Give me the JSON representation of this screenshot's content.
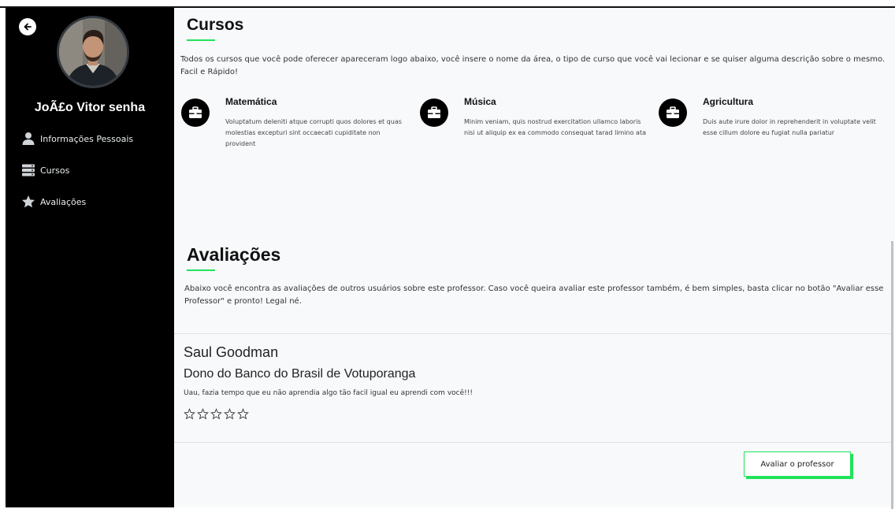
{
  "sidebar": {
    "profile_name": "JoÃ£o Vitor senha",
    "nav": [
      {
        "label": "Informações Pessoais",
        "icon": "user-icon"
      },
      {
        "label": "Cursos",
        "icon": "server-icon"
      },
      {
        "label": "Avaliações",
        "icon": "star-icon"
      }
    ]
  },
  "cursos": {
    "title": "Cursos",
    "description": "Todos os cursos que você pode oferecer apareceram logo abaixo, você insere o nome da área, o tipo de curso que você vai lecionar e se quiser alguma descrição sobre o mesmo. Facil e Rápido!",
    "items": [
      {
        "title": "Matemática",
        "text": "Voluptatum deleniti atque corrupti quos dolores et quas molestias excepturi sint occaecati cupiditate non provident",
        "icon": "briefcase-icon"
      },
      {
        "title": "Música",
        "text": "Minim veniam, quis nostrud exercitation ullamco laboris nisi ut aliquip ex ea commodo consequat tarad limino ata",
        "icon": "briefcase-icon"
      },
      {
        "title": "Agricultura",
        "text": "Duis aute irure dolor in reprehenderit in voluptate velit esse cillum dolore eu fugiat nulla pariatur",
        "icon": "briefcase-icon"
      }
    ]
  },
  "avaliacoes": {
    "title": "Avaliações",
    "description": "Abaixo você encontra as avaliações de outros usuários sobre este professor. Caso você queira avaliar este professor também, é bem simples, basta clicar no botão \"Avaliar esse Professor\" e pronto! Legal né.",
    "reviews": [
      {
        "name": "Saul Goodman",
        "role": "Dono do Banco do Brasil de Votuporanga",
        "text": "Uau, fazia tempo que eu não aprendia algo tão facil igual eu aprendi com você!!!",
        "rating": 0,
        "max_rating": 5
      }
    ],
    "button_label": "Avaliar o professor"
  },
  "colors": {
    "accent": "#21e35a",
    "sidebar_bg": "#000000"
  }
}
